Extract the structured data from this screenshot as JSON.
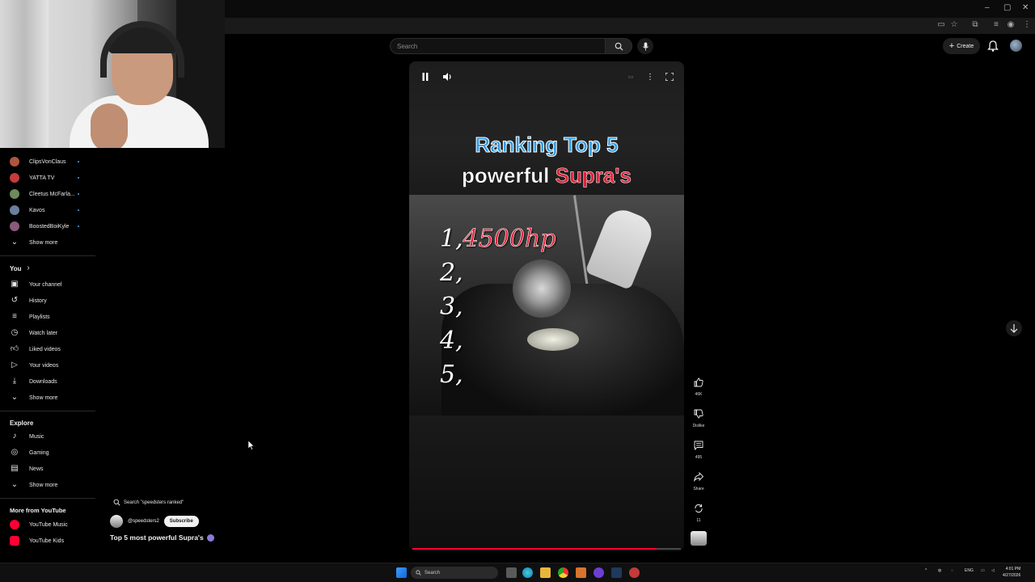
{
  "browser": {
    "window_controls": [
      "–",
      "▢",
      "✕"
    ]
  },
  "sidebar": {
    "subscriptions": [
      {
        "label": "ClipsVonClaus",
        "color": "#b0563d"
      },
      {
        "label": "YATTA TV",
        "color": "#c43b3b"
      },
      {
        "label": "Cleetus McFarla...",
        "color": "#6d8a5a"
      },
      {
        "label": "Kavos",
        "color": "#6b7f9e"
      },
      {
        "label": "BoostedBoiKyle",
        "color": "#8a5a7a"
      }
    ],
    "subs_show_more": "Show more",
    "you_heading": "You",
    "you_items": [
      {
        "label": "Your channel",
        "icon": "channel-icon"
      },
      {
        "label": "History",
        "icon": "history-icon"
      },
      {
        "label": "Playlists",
        "icon": "playlists-icon"
      },
      {
        "label": "Watch later",
        "icon": "watch-later-icon"
      },
      {
        "label": "Liked videos",
        "icon": "liked-icon"
      },
      {
        "label": "Your videos",
        "icon": "your-videos-icon"
      },
      {
        "label": "Downloads",
        "icon": "downloads-icon"
      }
    ],
    "you_show_more": "Show more",
    "explore_heading": "Explore",
    "explore_items": [
      {
        "label": "Music",
        "icon": "music-icon"
      },
      {
        "label": "Gaming",
        "icon": "gaming-icon"
      },
      {
        "label": "News",
        "icon": "news-icon"
      }
    ],
    "explore_show_more": "Show more",
    "more_heading": "More from YouTube",
    "more_items": [
      {
        "label": "YouTube Music",
        "color": "#ff0033"
      },
      {
        "label": "YouTube Kids",
        "color": "#ff0033"
      }
    ]
  },
  "header": {
    "search_placeholder": "Search",
    "create_label": "Create"
  },
  "video": {
    "overlay_line1": "Ranking Top 5",
    "overlay_line2_white": "powerful ",
    "overlay_line2_red": "Supra's",
    "ranks": [
      {
        "number": "1,",
        "value": "4500hp"
      },
      {
        "number": "2,",
        "value": ""
      },
      {
        "number": "3,",
        "value": ""
      },
      {
        "number": "4,",
        "value": ""
      },
      {
        "number": "5,",
        "value": ""
      }
    ],
    "progress_fraction": 0.91
  },
  "actions": {
    "like_count": "46K",
    "dislike_label": "Dislike",
    "comments_count": "495",
    "share_label": "Share",
    "remix_count": "11"
  },
  "shorts_info": {
    "search_chip": "Search \"speedsters ranked\"",
    "channel_handle": "@speedsters2",
    "subscribe_label": "Subscribe",
    "title": "Top 5 most powerful Supra's"
  },
  "taskbar": {
    "search_label": "Search",
    "language": "ENG",
    "time": "4:01 PM",
    "date": "4/27/2026"
  },
  "colors": {
    "accent_red": "#ff0033",
    "overlay_blue": "#2f9be0",
    "overlay_red": "#e0223a",
    "background": "#000000"
  }
}
